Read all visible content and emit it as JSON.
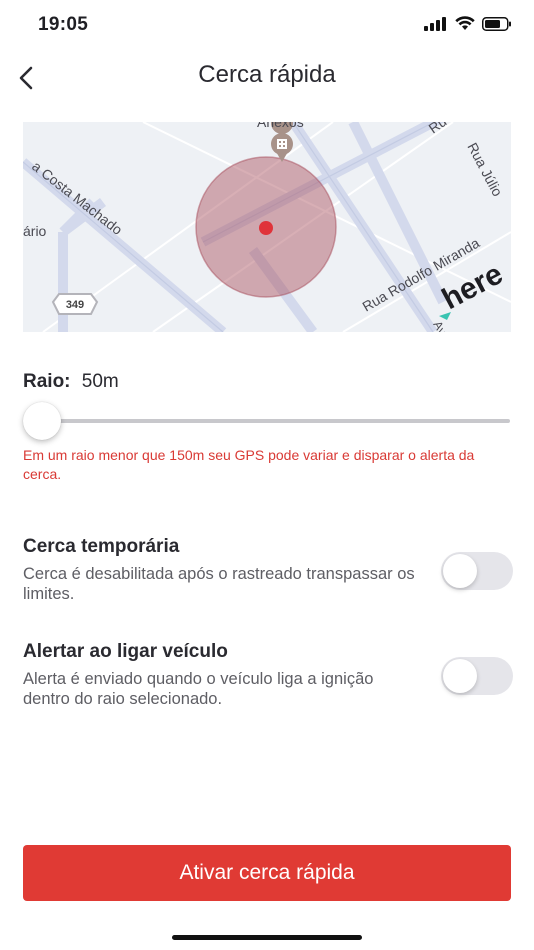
{
  "status_bar": {
    "time": "19:05"
  },
  "nav": {
    "title": "Cerca rápida"
  },
  "map": {
    "labels": {
      "anexos": "Anexos",
      "ru_top": "Ru",
      "rua_julio": "Rua Júlio",
      "costa_machado": "a Costa Machado",
      "ario": "ário",
      "rua_rodolfo": "Rua Rodolfo Miranda",
      "route": "349",
      "brand": "here",
      "av": "Av"
    },
    "circle_color": "#a84e5c"
  },
  "radius": {
    "label": "Raio:",
    "value": "50m",
    "slider_level_fraction": 0.0
  },
  "warning": "Em um raio menor que 150m seu GPS pode variar e disparar o alerta da cerca.",
  "settings": [
    {
      "title": "Cerca temporária",
      "description": "Cerca é desabilitada após o rastreado transpassar os limites.",
      "enabled": false
    },
    {
      "title": "Alertar ao ligar veículo",
      "description": "Alerta é enviado quando o veículo liga a ignição dentro do raio selecionado.",
      "enabled": false
    }
  ],
  "action_button": {
    "label": "Ativar cerca rápida"
  },
  "colors": {
    "accent": "#e03a34",
    "warning_text": "#d93a35"
  }
}
